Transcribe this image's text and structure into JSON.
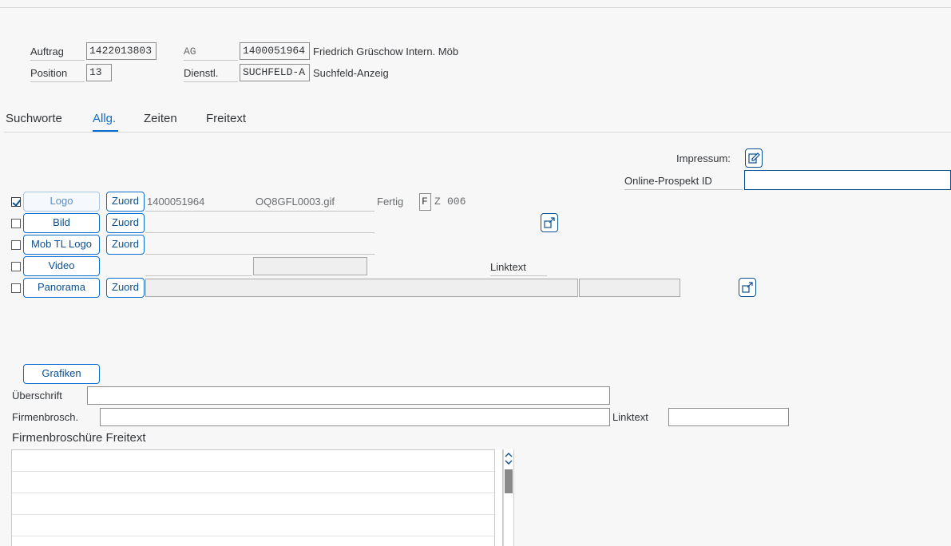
{
  "header": {
    "auftrag_label": "Auftrag",
    "auftrag_value": "1422013803",
    "position_label": "Position",
    "position_value": "13",
    "ag_label": "AG",
    "ag_value": "1400051964",
    "ag_name": "Friedrich Grüschow Intern. Möb",
    "dienstl_label": "Dienstl.",
    "dienstl_value": "SUCHFELD-A",
    "dienstl_name": "Suchfeld-Anzeig"
  },
  "tabs": [
    {
      "label": "Suchworte",
      "active": false
    },
    {
      "label": "Allg.",
      "active": true
    },
    {
      "label": "Zeiten",
      "active": false
    },
    {
      "label": "Freitext",
      "active": false
    }
  ],
  "impressum_label": "Impressum:",
  "online_prospekt_label": "Online-Prospekt ID",
  "online_prospekt_value": "",
  "media_rows": [
    {
      "name": "logo",
      "checked": true,
      "button": "Logo",
      "zuord": "Zuord",
      "id": "1400051964",
      "file": "OQ8GFL0003.gif",
      "status": "Fertig",
      "flag": "F",
      "z_label": "Z",
      "z_value": "006"
    },
    {
      "name": "bild",
      "checked": false,
      "button": "Bild",
      "zuord": "Zuord"
    },
    {
      "name": "mobtllogo",
      "checked": false,
      "button": "Mob TL Logo",
      "zuord": "Zuord"
    },
    {
      "name": "video",
      "checked": false,
      "button": "Video",
      "linktext": "Linktext"
    },
    {
      "name": "panorama",
      "checked": false,
      "button": "Panorama",
      "zuord": "Zuord"
    }
  ],
  "grafiken_button": "Grafiken",
  "ueberschrift_label": "Überschrift",
  "ueberschrift_value": "",
  "firmenbrosch_label": "Firmenbrosch.",
  "firmenbrosch_value": "",
  "linktext_label": "Linktext",
  "linktext_value": "",
  "freitext_title": "Firmenbroschüre Freitext",
  "icons": {
    "impressum": "edit-icon",
    "export": "external-link-icon",
    "scroll_up": "chevron-up-icon",
    "scroll_down": "chevron-down-icon"
  },
  "colors": {
    "accent": "#0a6ed1",
    "button_text": "#0a4f8f",
    "background": "#f7f7f7"
  }
}
